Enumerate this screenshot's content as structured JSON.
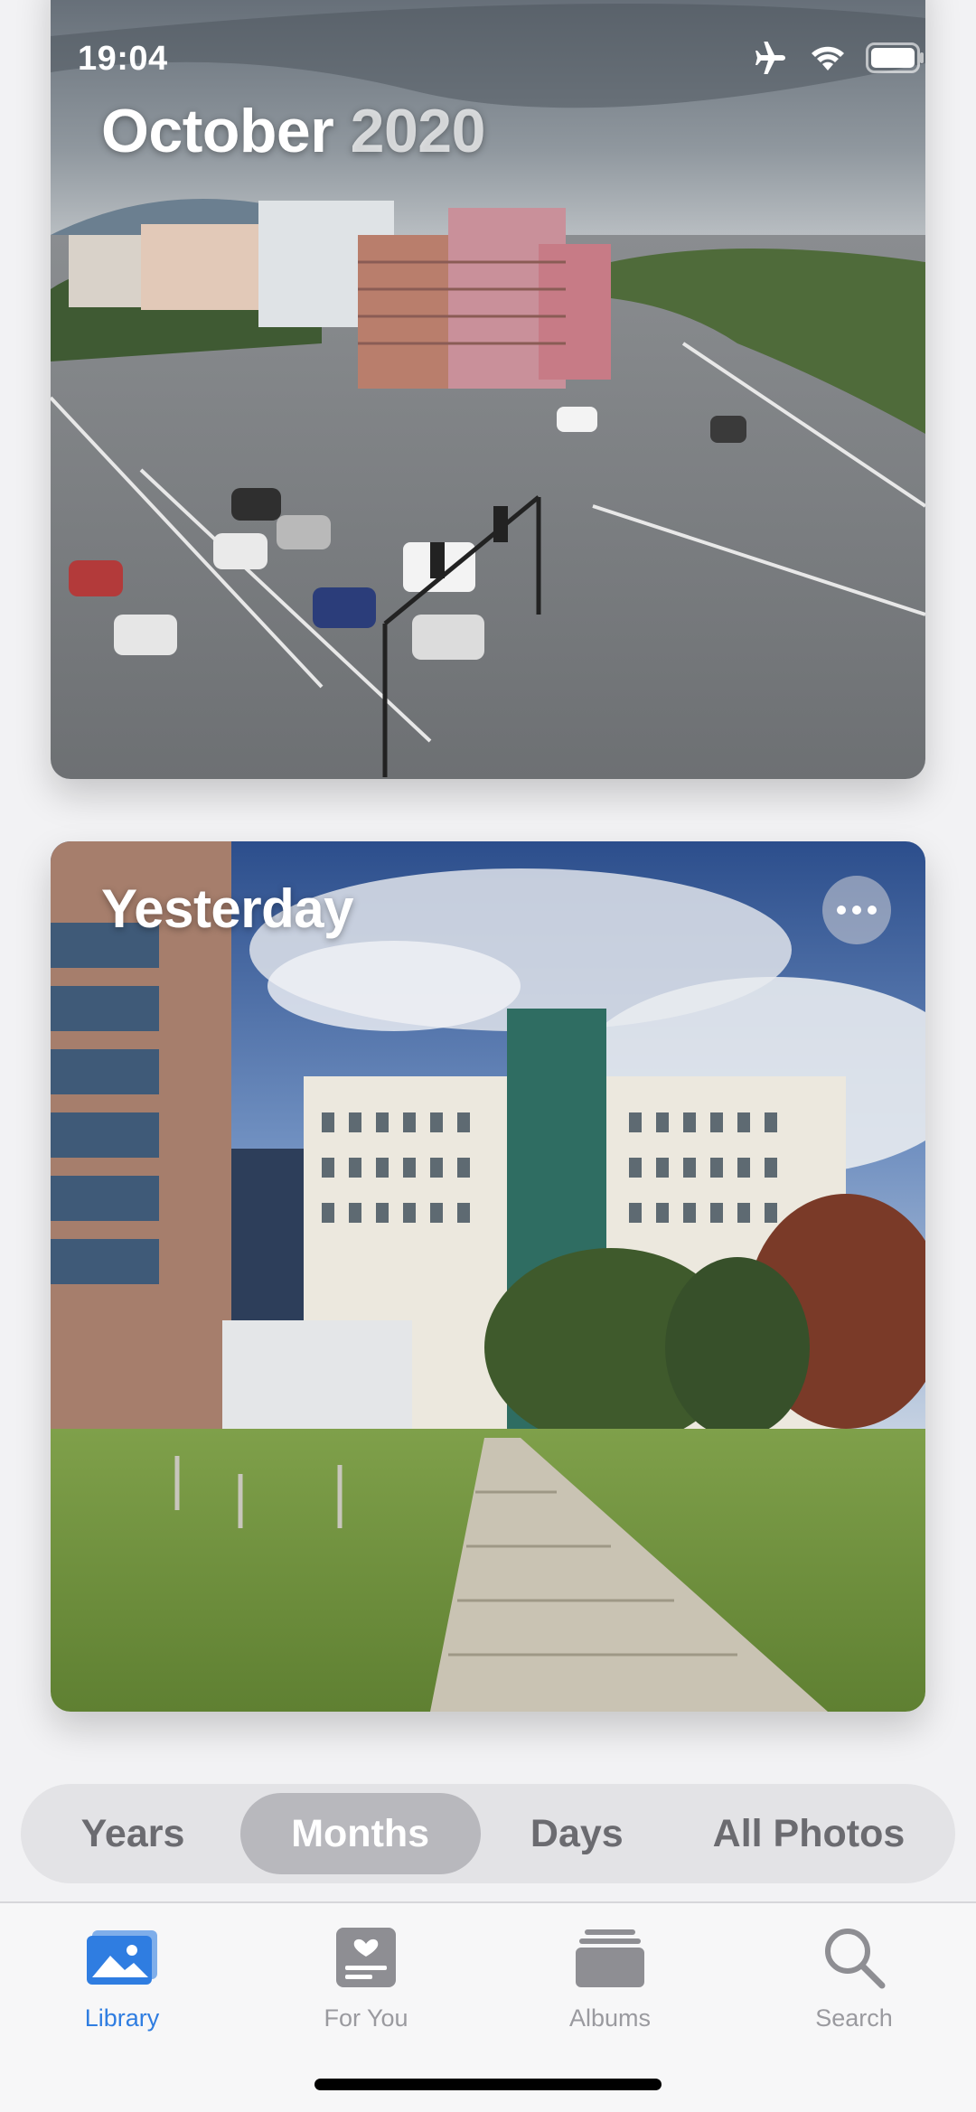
{
  "status_bar": {
    "time": "19:04",
    "icons": [
      "airplane-icon",
      "wifi-icon",
      "battery-icon"
    ]
  },
  "cards": [
    {
      "title_month": "October",
      "title_year": "2020",
      "scene": "aerial city street intersection photo"
    },
    {
      "title": "Yesterday",
      "more_icon": "ellipsis-icon",
      "scene": "hotel building with lawn and stone path photo"
    }
  ],
  "segmented_control": {
    "options": [
      "Years",
      "Months",
      "Days",
      "All Photos"
    ],
    "selected": "Months"
  },
  "tab_bar": {
    "items": [
      {
        "label": "Library",
        "icon": "library-icon",
        "active": true
      },
      {
        "label": "For You",
        "icon": "for-you-icon",
        "active": false
      },
      {
        "label": "Albums",
        "icon": "albums-icon",
        "active": false
      },
      {
        "label": "Search",
        "icon": "search-icon",
        "active": false
      }
    ],
    "active_color": "#2f7de1",
    "inactive_color": "#9a9a9f"
  }
}
